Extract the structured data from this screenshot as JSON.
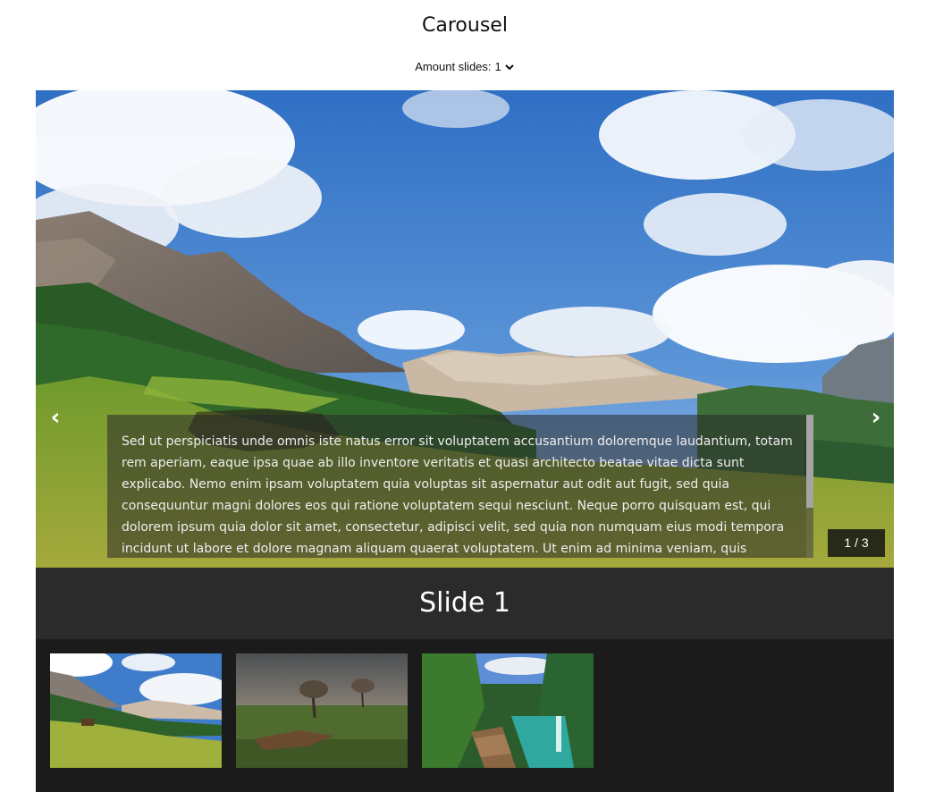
{
  "header": {
    "title": "Carousel",
    "amount_label": "Amount slides:",
    "amount_value": "1"
  },
  "carousel": {
    "prev_glyph": "‹",
    "next_glyph": "›",
    "caption": "Sed ut perspiciatis unde omnis iste natus error sit voluptatem accusantium doloremque laudantium, totam rem aperiam, eaque ipsa quae ab illo inventore veritatis et quasi architecto beatae vitae dicta sunt explicabo. Nemo enim ipsam voluptatem quia voluptas sit aspernatur aut odit aut fugit, sed quia consequuntur magni dolores eos qui ratione voluptatem sequi nesciunt. Neque porro quisquam est, qui dolorem ipsum quia dolor sit amet, consectetur, adipisci velit, sed quia non numquam eius modi tempora incidunt ut labore et dolore magnam aliquam quaerat voluptatem. Ut enim ad minima veniam, quis nostrum",
    "counter": "1 / 3",
    "slide_title": "Slide 1"
  },
  "thumbnails": [
    {
      "subject": "alpine-meadow-mountains"
    },
    {
      "subject": "field-with-trees-dusk"
    },
    {
      "subject": "waterfall-boardwalk"
    }
  ],
  "colors": {
    "carousel_bg": "#1b1b1b",
    "title_bar_bg": "#2b2b2b",
    "text_on_dark": "#ffffff"
  }
}
